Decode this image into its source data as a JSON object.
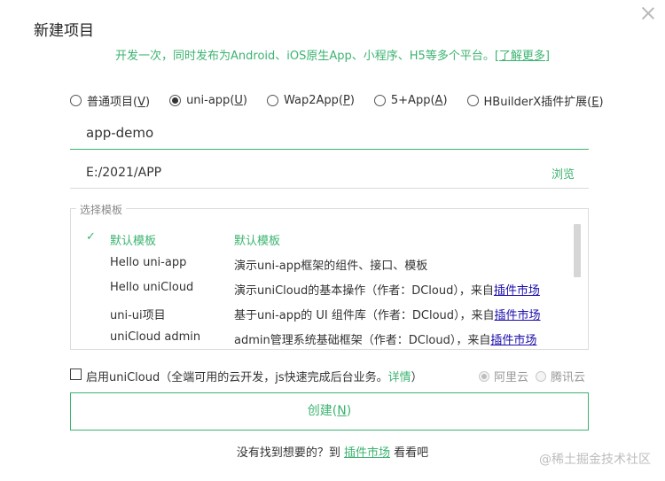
{
  "dialog": {
    "title": "新建项目",
    "subtitle": "开发一次，同时发布为Android、iOS原生App、小程序、H5等多个平台。",
    "learn_more": "[了解更多]"
  },
  "project_types": [
    {
      "label": "普通项目(",
      "key": "V",
      "tail": ")",
      "checked": false
    },
    {
      "label": "uni-app(",
      "key": "U",
      "tail": ")",
      "checked": true
    },
    {
      "label": "Wap2App(",
      "key": "P",
      "tail": ")",
      "checked": false
    },
    {
      "label": "5+App(",
      "key": "A",
      "tail": ")",
      "checked": false
    },
    {
      "label": "HBuilderX插件扩展(",
      "key": "E",
      "tail": ")",
      "checked": false
    }
  ],
  "fields": {
    "name_value": "app-demo",
    "path_value": "E:/2021/APP",
    "browse_label": "浏览"
  },
  "templates": {
    "legend": "选择模板",
    "check_mark": "✓",
    "rows": [
      {
        "name": "默认模板",
        "desc": "默认模板",
        "desc_suffix": "",
        "link": "",
        "selected": true
      },
      {
        "name": "Hello uni-app",
        "desc": "演示uni-app框架的组件、接口、模板",
        "desc_suffix": "",
        "link": "",
        "selected": false
      },
      {
        "name": "Hello uniCloud",
        "desc": "演示uniCloud的基本操作（作者：DCloud），来自",
        "link": "插件市场",
        "selected": false
      },
      {
        "name": "uni-ui项目",
        "desc": "基于uni-app的 UI 组件库（作者：DCloud），来自",
        "link": "插件市场",
        "selected": false
      },
      {
        "name": "uniCloud admin",
        "desc": "admin管理系统基础框架（作者：DCloud），来自",
        "link": "插件市场",
        "selected": false
      }
    ]
  },
  "unicloud": {
    "label": "启用uniCloud（全端可用的云开发，js快速完成后台业务。",
    "detail_link": "详情",
    "close_paren": "）",
    "providers": [
      {
        "label": "阿里云",
        "checked": true
      },
      {
        "label": "腾讯云",
        "checked": false
      }
    ]
  },
  "create_button": {
    "label": "创建(",
    "key": "N",
    "tail": ")"
  },
  "footer": {
    "prefix": "没有找到想要的？到 ",
    "link": "插件市场",
    "suffix": " 看看吧"
  },
  "watermark": "@稀土掘金技术社区"
}
